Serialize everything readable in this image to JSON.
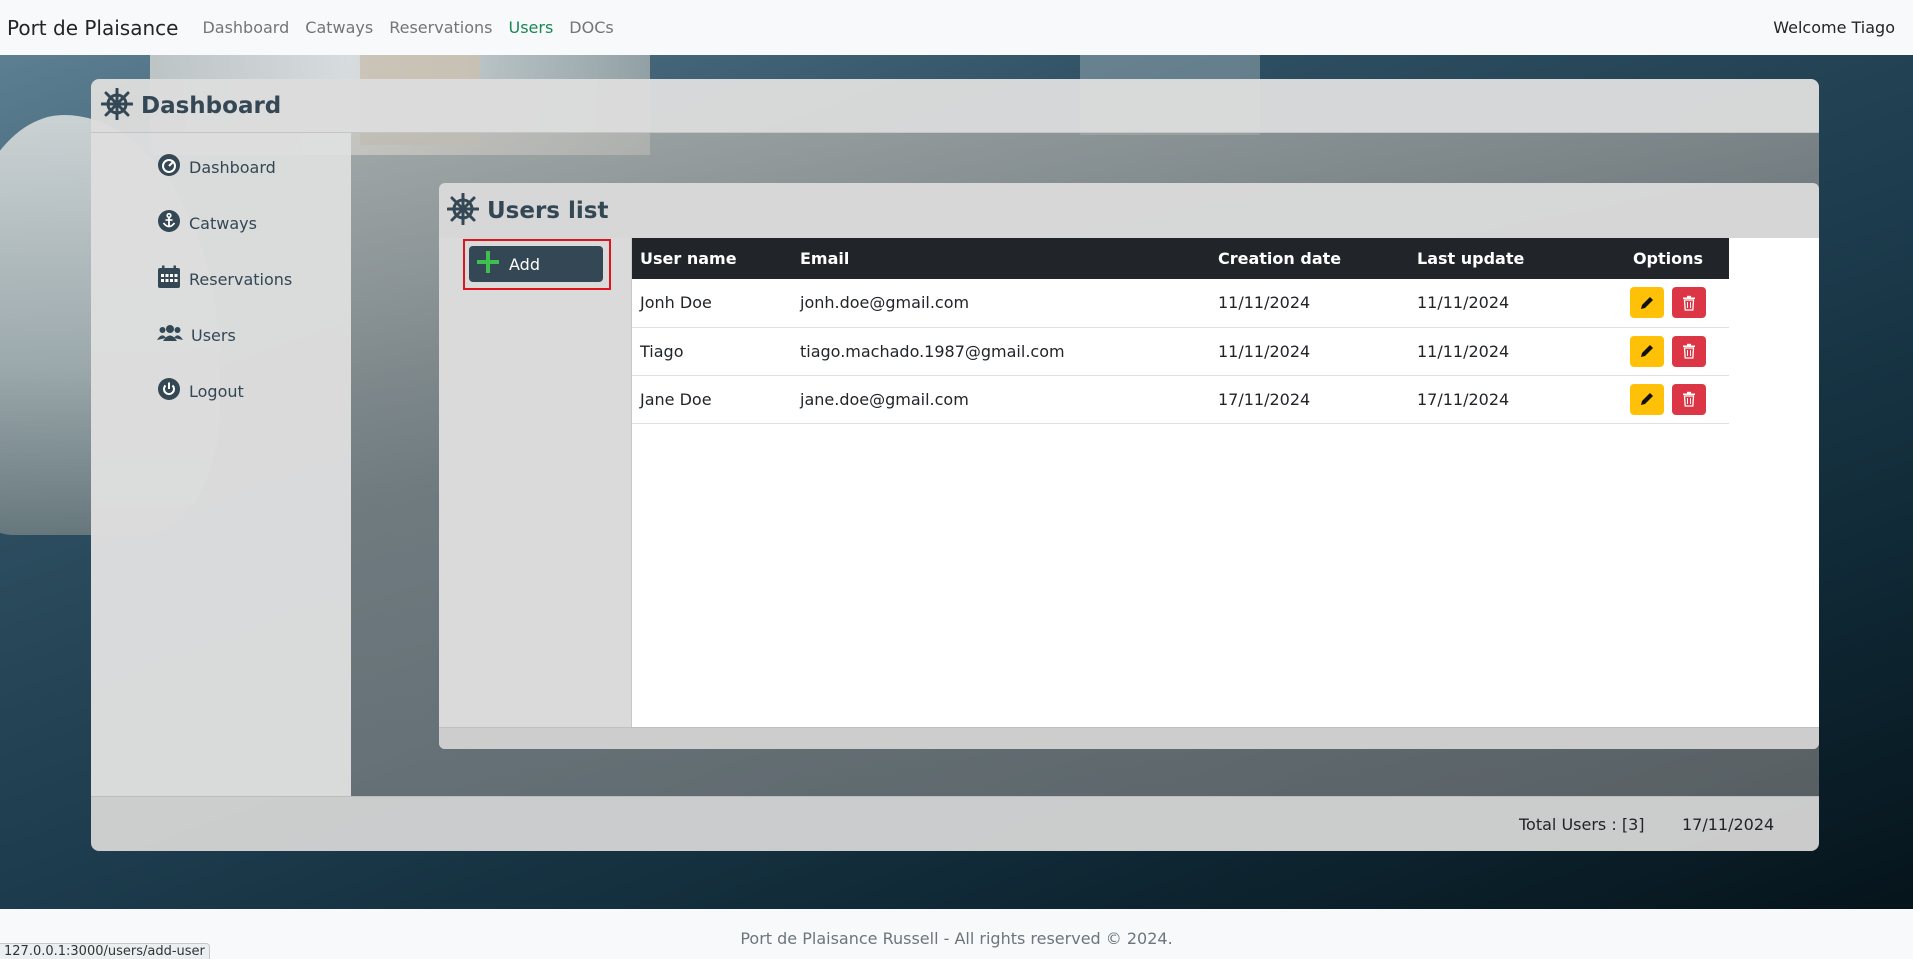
{
  "navbar": {
    "brand": "Port de Plaisance",
    "links": [
      "Dashboard",
      "Catways",
      "Reservations",
      "Users",
      "DOCs"
    ],
    "active": "Users",
    "welcome": "Welcome Tiago"
  },
  "panel": {
    "title": "Dashboard",
    "icon": "ship-wheel-icon",
    "sidebar": [
      {
        "label": "Dashboard",
        "icon": "gauge-icon"
      },
      {
        "label": "Catways",
        "icon": "anchor-icon"
      },
      {
        "label": "Reservations",
        "icon": "calendar-icon"
      },
      {
        "label": "Users",
        "icon": "users-icon"
      },
      {
        "label": "Logout",
        "icon": "power-icon"
      }
    ],
    "footer": {
      "total": "Total Users : [3]",
      "date": "17/11/2024"
    }
  },
  "users_card": {
    "title": "Users list",
    "add_label": "Add",
    "columns": [
      "User name",
      "Email",
      "Creation date",
      "Last update",
      "Options"
    ],
    "rows": [
      {
        "name": "Jonh Doe",
        "email": "jonh.doe@gmail.com",
        "created": "11/11/2024",
        "updated": "11/11/2024"
      },
      {
        "name": "Tiago",
        "email": "tiago.machado.1987@gmail.com",
        "created": "11/11/2024",
        "updated": "11/11/2024"
      },
      {
        "name": "Jane Doe",
        "email": "jane.doe@gmail.com",
        "created": "17/11/2024",
        "updated": "17/11/2024"
      }
    ]
  },
  "footer": {
    "text": "Port de Plaisance Russell - All rights reserved © 2024."
  },
  "status_url": "127.0.0.1:3000/users/add-user",
  "colors": {
    "accent_dark": "#344754",
    "active_nav": "#198754",
    "edit_button": "#ffc107",
    "delete_button": "#dc3545",
    "add_outline": "#e0151b"
  }
}
